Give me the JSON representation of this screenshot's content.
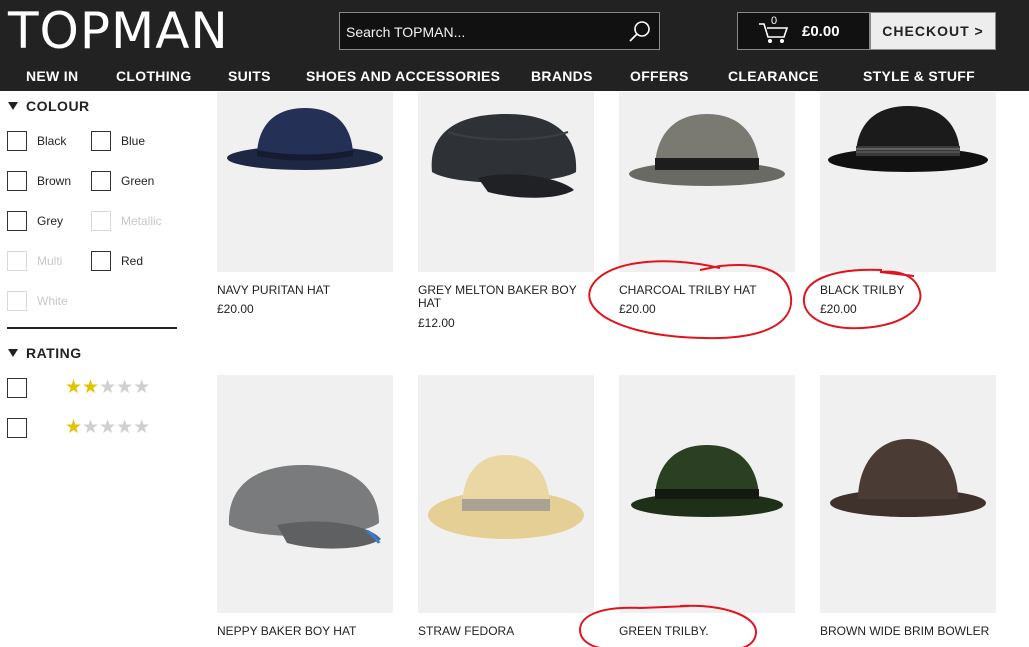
{
  "header": {
    "logo": "TOPMAN",
    "search_placeholder": "Search TOPMAN...",
    "cart_count": "0",
    "cart_total": "£0.00",
    "checkout_label": "CHECKOUT >"
  },
  "nav": [
    "NEW IN",
    "CLOTHING",
    "SUITS",
    "SHOES AND ACCESSORIES",
    "BRANDS",
    "OFFERS",
    "CLEARANCE",
    "STYLE & STUFF"
  ],
  "filters": {
    "colour": {
      "title": "COLOUR",
      "options": [
        {
          "label": "Black",
          "enabled": true
        },
        {
          "label": "Blue",
          "enabled": true
        },
        {
          "label": "Brown",
          "enabled": true
        },
        {
          "label": "Green",
          "enabled": true
        },
        {
          "label": "Grey",
          "enabled": true
        },
        {
          "label": "Metallic",
          "enabled": false
        },
        {
          "label": "Multi",
          "enabled": false
        },
        {
          "label": "Red",
          "enabled": true
        },
        {
          "label": "White",
          "enabled": false
        }
      ]
    },
    "rating": {
      "title": "RATING",
      "options": [
        {
          "stars": 2,
          "out_of": 5
        },
        {
          "stars": 1,
          "out_of": 5
        }
      ]
    }
  },
  "products": [
    {
      "name": "NAVY PURITAN HAT",
      "price": "£20.00"
    },
    {
      "name": "GREY MELTON BAKER BOY HAT",
      "price": "£12.00"
    },
    {
      "name": "CHARCOAL TRILBY HAT",
      "price": "£20.00"
    },
    {
      "name": "BLACK TRILBY",
      "price": "£20.00"
    },
    {
      "name": "NEPPY BAKER BOY HAT",
      "price": ""
    },
    {
      "name": "STRAW FEDORA",
      "price": ""
    },
    {
      "name": "GREEN TRILBY.",
      "price": ""
    },
    {
      "name": "BROWN WIDE BRIM BOWLER",
      "price": ""
    }
  ],
  "colors": {
    "header_bg": "#222222",
    "star_filled": "#e3c200",
    "star_empty": "#cfcfcf",
    "annotation_red": "#e0141e"
  }
}
